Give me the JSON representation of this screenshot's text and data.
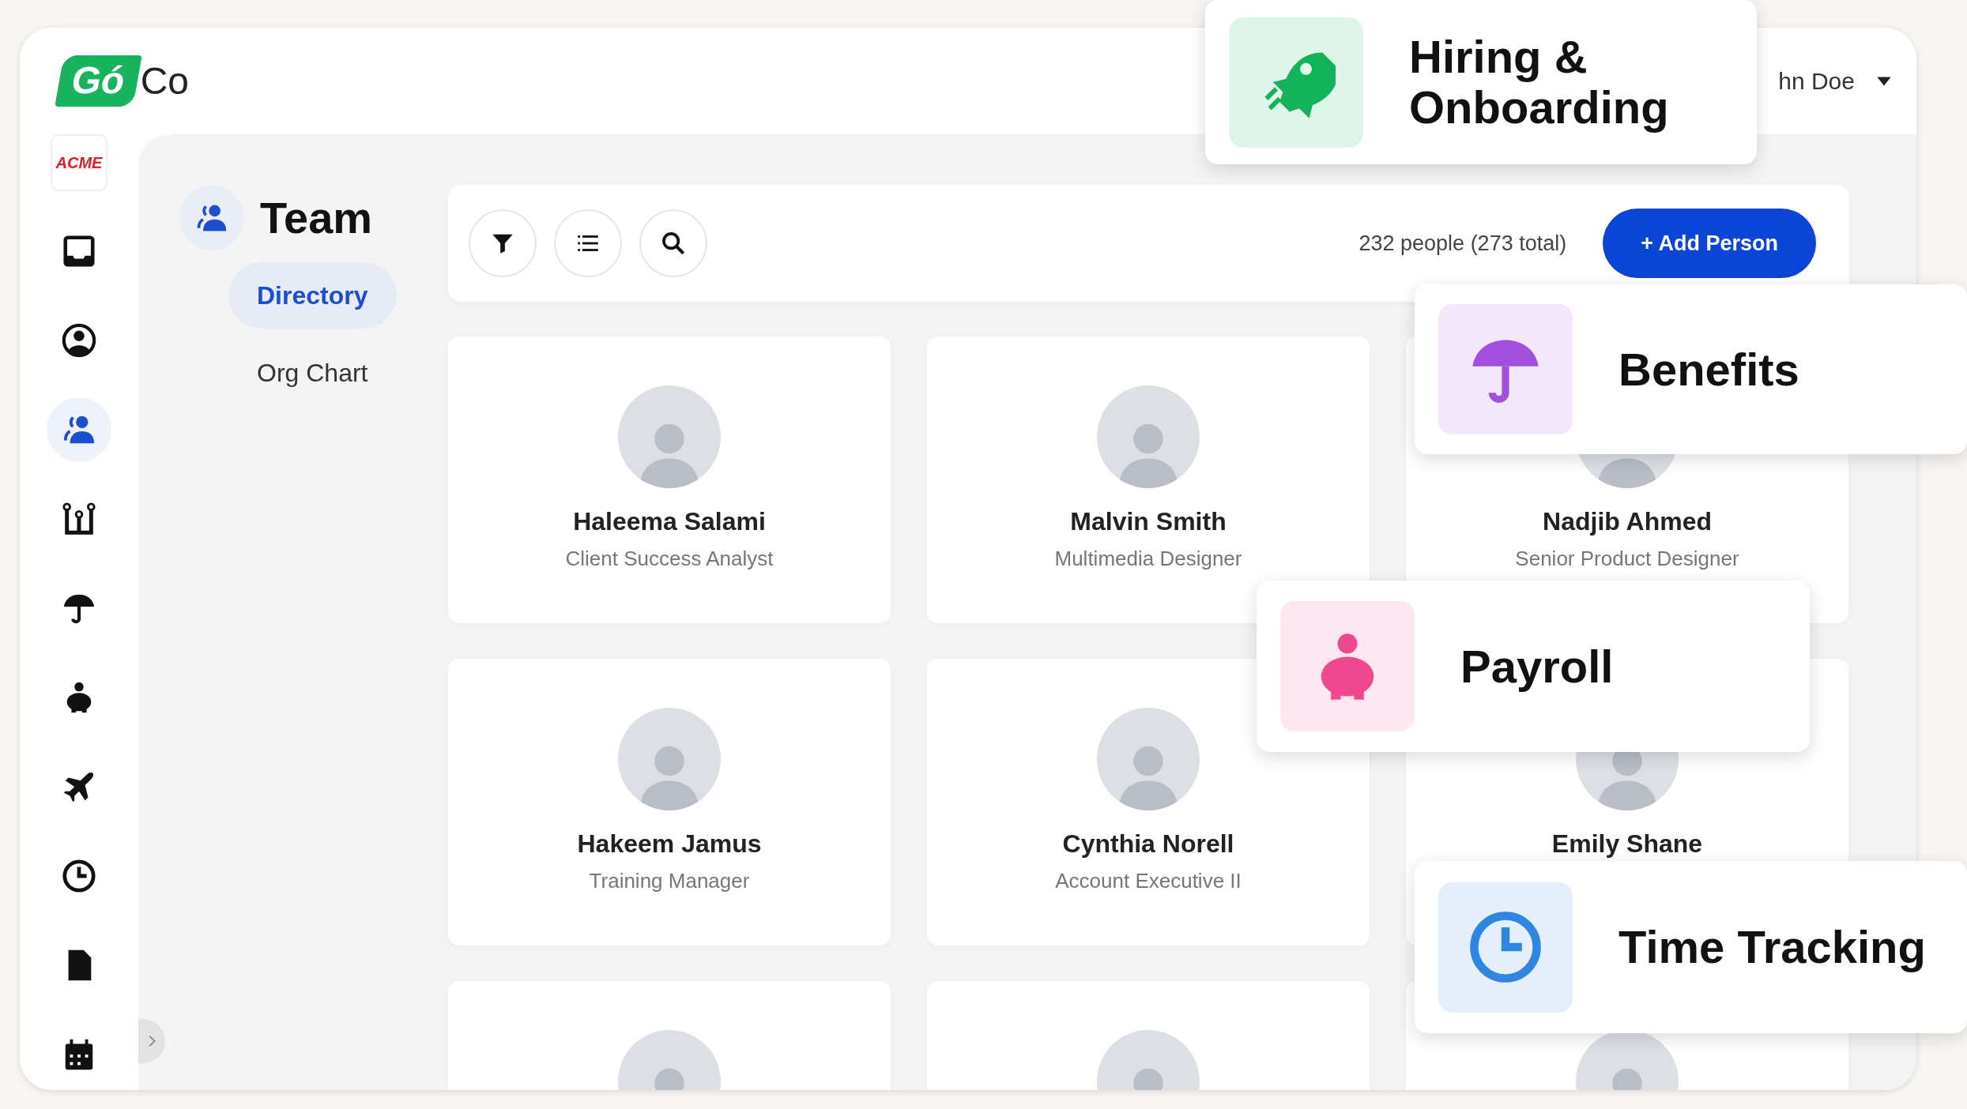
{
  "header": {
    "logo": {
      "mark": "Gó",
      "text": "Co"
    },
    "user": "hn Doe"
  },
  "sidebar": {
    "company_logo": "ACME",
    "items": [
      {
        "kind": "inbox",
        "selected": false
      },
      {
        "kind": "profile",
        "selected": false
      },
      {
        "kind": "team",
        "selected": true
      },
      {
        "kind": "org",
        "selected": false
      },
      {
        "kind": "benefits",
        "selected": false
      },
      {
        "kind": "payroll",
        "selected": false
      },
      {
        "kind": "travel",
        "selected": false
      },
      {
        "kind": "time",
        "selected": false
      },
      {
        "kind": "document",
        "selected": false
      },
      {
        "kind": "calendar",
        "selected": false
      }
    ]
  },
  "section": {
    "title": "Team",
    "nav": [
      {
        "label": "Directory",
        "selected": true
      },
      {
        "label": "Org Chart",
        "selected": false
      }
    ]
  },
  "toolbar": {
    "tools": [
      {
        "kind": "filter"
      },
      {
        "kind": "list"
      },
      {
        "kind": "search"
      }
    ],
    "count": "232 people (273 total)",
    "add_button": "+ Add Person"
  },
  "people": [
    {
      "kind": "full",
      "name": "Haleema Salami",
      "title": "Client Success Analyst"
    },
    {
      "kind": "full",
      "name": "Malvin Smith",
      "title": "Multimedia Designer"
    },
    {
      "kind": "full",
      "name": "Nadjib Ahmed",
      "title": "Senior Product Designer"
    },
    {
      "kind": "full",
      "name": "Hakeem Jamus",
      "title": "Training Manager"
    },
    {
      "kind": "full",
      "name": "Cynthia Norell",
      "title": "Account Executive II"
    },
    {
      "kind": "full",
      "name": "Emily Shane"
    },
    {
      "kind": "cut_off"
    },
    {
      "kind": "cut_off"
    },
    {
      "kind": "cut_off"
    }
  ],
  "features": [
    {
      "kind": "hiring",
      "title": "Hiring & Onboarding",
      "color": "#12b35a"
    },
    {
      "kind": "benefits",
      "title": "Benefits",
      "color": "#a24fe0"
    },
    {
      "kind": "payroll",
      "title": "Payroll",
      "color": "#f0488f"
    },
    {
      "kind": "time",
      "title": "Time Tracking",
      "color": "#2f86e0"
    }
  ]
}
